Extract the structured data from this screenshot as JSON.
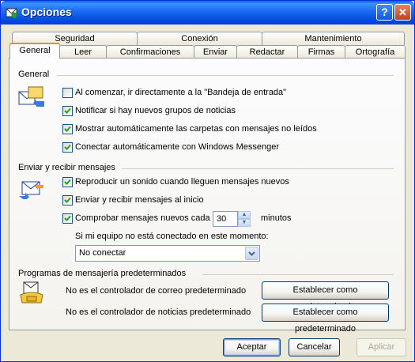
{
  "window": {
    "title": "Opciones"
  },
  "tabs_top": [
    "Seguridad",
    "Conexión",
    "Mantenimiento"
  ],
  "tabs_bottom": [
    "General",
    "Leer",
    "Confirmaciones",
    "Enviar",
    "Redactar",
    "Firmas",
    "Ortografía"
  ],
  "active_tab": "General",
  "general": {
    "title": "General",
    "options": [
      {
        "label": "Al comenzar, ir directamente a la \"Bandeja de entrada\"",
        "checked": false
      },
      {
        "label": "Notificar si hay nuevos grupos de noticias",
        "checked": true
      },
      {
        "label": "Mostrar automáticamente las carpetas con mensajes no leídos",
        "checked": true
      },
      {
        "label": "Conectar automáticamente con Windows Messenger",
        "checked": true
      }
    ]
  },
  "send_receive": {
    "title": "Enviar y recibir mensajes",
    "options": [
      {
        "label": "Reproducir un sonido cuando lleguen mensajes nuevos",
        "checked": true
      },
      {
        "label": "Enviar y recibir mensajes al inicio",
        "checked": true
      },
      {
        "label": "Comprobar mensajes nuevos cada",
        "checked": true
      }
    ],
    "interval_value": "30",
    "interval_unit": "minutos",
    "offline_label": "Si mi equipo no está conectado en este momento:",
    "offline_selected": "No conectar"
  },
  "default_programs": {
    "title": "Programas de mensajería predeterminados",
    "mail_text": "No es el controlador de correo predeterminado",
    "news_text": "No es el controlador de noticias predeterminado",
    "set_default_label": "Establecer como predeterminado"
  },
  "footer": {
    "ok": "Aceptar",
    "cancel": "Cancelar",
    "apply": "Aplicar"
  },
  "colors": {
    "title_bar": "#0054e3",
    "dialog_bg": "#ece9d8",
    "active_tab_accent": "#e68b2c",
    "check": "#21a121"
  }
}
